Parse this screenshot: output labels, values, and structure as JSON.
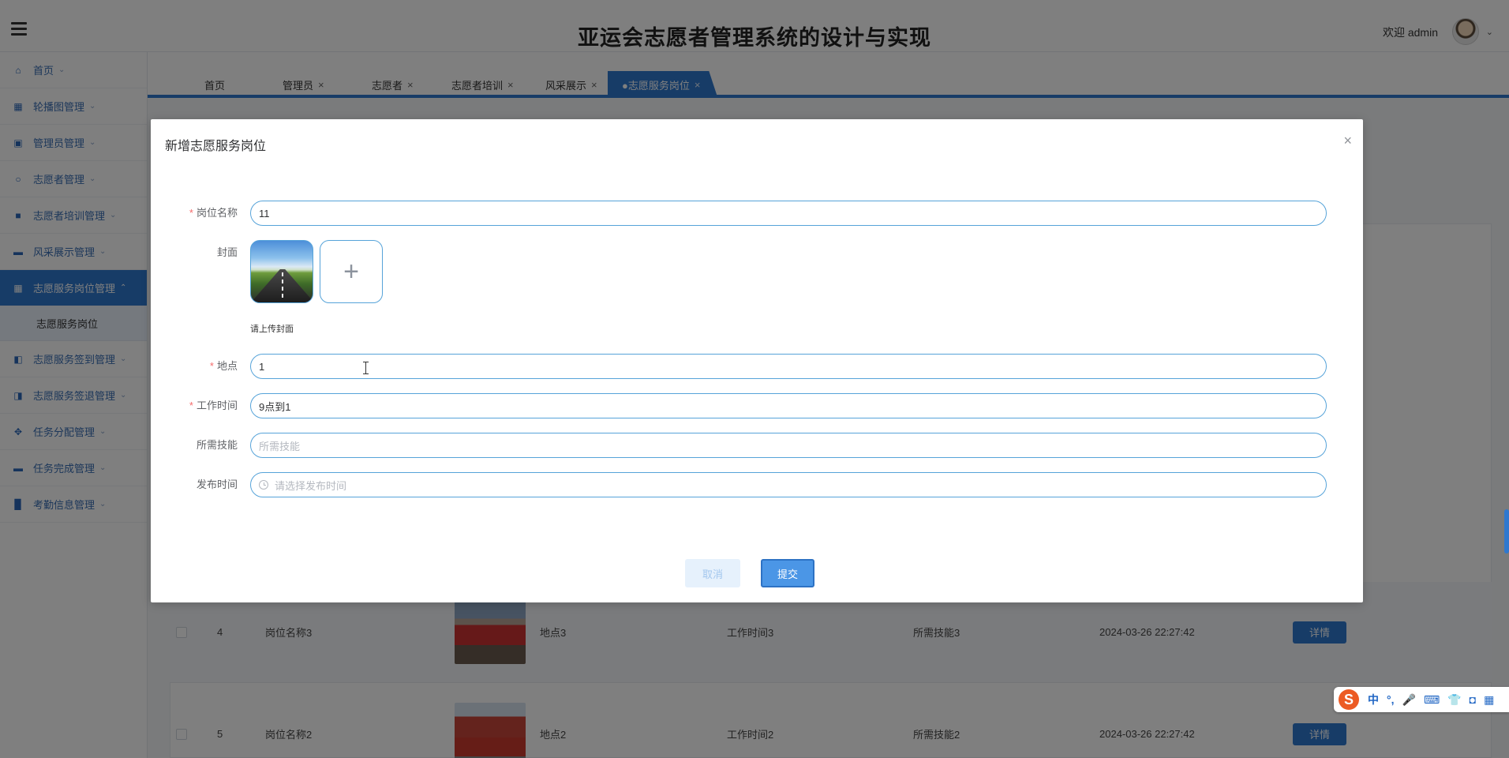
{
  "header": {
    "title": "亚运会志愿者管理系统的设计与实现",
    "welcome": "欢迎 admin",
    "menu_icon": "hamburger-icon",
    "avatar_icon": "avatar"
  },
  "sidebar": {
    "items": [
      {
        "label": "首页",
        "icon": "home-icon"
      },
      {
        "label": "轮播图管理",
        "icon": "image-icon"
      },
      {
        "label": "管理员管理",
        "icon": "user-icon"
      },
      {
        "label": "志愿者管理",
        "icon": "badge-icon"
      },
      {
        "label": "志愿者培训管理",
        "icon": "book-icon"
      },
      {
        "label": "风采展示管理",
        "icon": "display-icon"
      },
      {
        "label": "志愿服务岗位管理",
        "icon": "grid-icon",
        "active": true
      },
      {
        "label": "志愿服务签到管理",
        "icon": "checkin-icon"
      },
      {
        "label": "志愿服务签退管理",
        "icon": "checkout-icon"
      },
      {
        "label": "任务分配管理",
        "icon": "apps-icon"
      },
      {
        "label": "任务完成管理",
        "icon": "task-icon"
      },
      {
        "label": "考勤信息管理",
        "icon": "chart-icon"
      }
    ],
    "active_sub": "志愿服务岗位"
  },
  "tabs": [
    {
      "label": "首页",
      "closable": false
    },
    {
      "label": "管理员",
      "closable": true
    },
    {
      "label": "志愿者",
      "closable": true
    },
    {
      "label": "志愿者培训",
      "closable": true
    },
    {
      "label": "风采展示",
      "closable": true
    },
    {
      "label": "●志愿服务岗位",
      "closable": true,
      "active": true
    }
  ],
  "table": {
    "rows": [
      {
        "index": "4",
        "name": "岗位名称3",
        "location": "地点3",
        "work_time": "工作时间3",
        "skills": "所需技能3",
        "published": "2024-03-26 22:27:42",
        "action": "详情"
      },
      {
        "index": "5",
        "name": "岗位名称2",
        "location": "地点2",
        "work_time": "工作时间2",
        "skills": "所需技能2",
        "published": "2024-03-26 22:27:42",
        "action": "详情"
      }
    ]
  },
  "dialog": {
    "title": "新增志愿服务岗位",
    "close_icon": "close-icon",
    "fields": {
      "name": {
        "label": "岗位名称",
        "required": true,
        "value": "11"
      },
      "cover": {
        "label": "封面",
        "hint": "请上传封面",
        "add_icon": "plus-icon"
      },
      "location": {
        "label": "地点",
        "required": true,
        "value": "1"
      },
      "work_time": {
        "label": "工作时间",
        "required": true,
        "value": "9点到1"
      },
      "skills": {
        "label": "所需技能",
        "required": false,
        "placeholder": "所需技能"
      },
      "publish_time": {
        "label": "发布时间",
        "required": false,
        "placeholder": "请选择发布时间"
      }
    },
    "buttons": {
      "cancel": "取消",
      "submit": "提交"
    }
  },
  "ime": {
    "logo": "S",
    "items": [
      "中",
      "°,",
      "🎤",
      "⌨",
      "👕",
      "◘",
      "▦",
      "⚙"
    ]
  },
  "colors": {
    "primary": "#2f78cf",
    "required": "#f56c6c",
    "input_border": "#56a3d9"
  }
}
